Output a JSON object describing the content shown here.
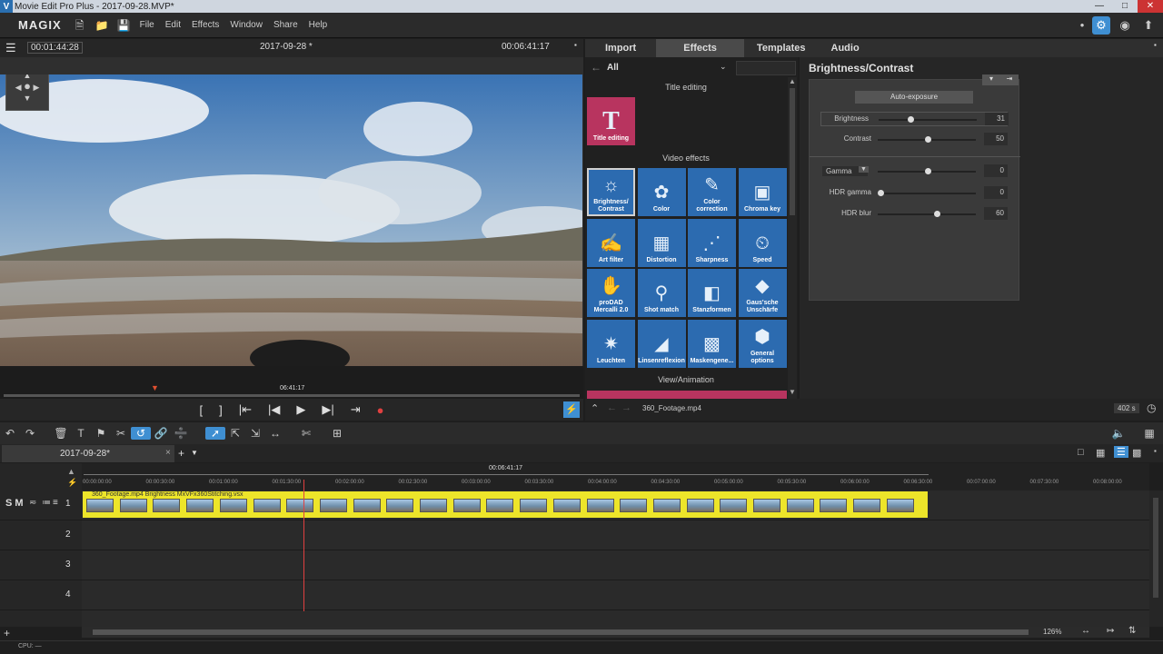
{
  "window": {
    "title": "Movie Edit Pro Plus - 2017-09-28.MVP*",
    "logo_letter": "V"
  },
  "menubar": {
    "brand": "MAGIX",
    "menus": [
      "File",
      "Edit",
      "Effects",
      "Window",
      "Share",
      "Help"
    ]
  },
  "monitor": {
    "timecode_left": "00:01:44:28",
    "project_title": "2017-09-28 *",
    "timecode_right": "00:06:41:17",
    "scrub_timecode": "06:41:17"
  },
  "media_pool": {
    "tabs": [
      "Import",
      "Effects",
      "Templates",
      "Audio"
    ],
    "active_tab": "Effects",
    "filter_value": "All",
    "section_title_editing": "Title editing",
    "title_tile_label": "Title editing",
    "section_video_effects": "Video effects",
    "section_view_animation": "View/Animation",
    "video_effects": [
      {
        "label": "Brightness/ Contrast",
        "icon": "sun-icon"
      },
      {
        "label": "Color",
        "icon": "palette-icon"
      },
      {
        "label": "Color correction",
        "icon": "color-correction-icon"
      },
      {
        "label": "Chroma key",
        "icon": "chroma-key-icon"
      },
      {
        "label": "Art filter",
        "icon": "art-filter-icon"
      },
      {
        "label": "Distortion",
        "icon": "distortion-icon"
      },
      {
        "label": "Sharpness",
        "icon": "sharpness-icon"
      },
      {
        "label": "Speed",
        "icon": "speed-icon"
      },
      {
        "label": "proDAD Mercalli 2.0",
        "icon": "hand-icon"
      },
      {
        "label": "Shot match",
        "icon": "shot-match-icon"
      },
      {
        "label": "Stanzformen",
        "icon": "stanzformen-icon"
      },
      {
        "label": "Gaus'sche Unschärfe",
        "icon": "drop-icon"
      },
      {
        "label": "Leuchten",
        "icon": "glow-icon"
      },
      {
        "label": "Linsenreflexion",
        "icon": "lens-flare-icon"
      },
      {
        "label": "Maskengene...",
        "icon": "mask-icon"
      },
      {
        "label": "General options",
        "icon": "hexagon-icon"
      }
    ]
  },
  "settings": {
    "heading": "Brightness/Contrast",
    "auto_exposure_label": "Auto-exposure",
    "sliders": [
      {
        "label": "Brightness",
        "value": "31",
        "fraction": 0.31
      },
      {
        "label": "Contrast",
        "value": "50",
        "fraction": 0.5
      },
      {
        "label": "Gamma",
        "value": "0",
        "fraction": 0.5
      },
      {
        "label": "HDR gamma",
        "value": "0",
        "fraction": 0.0
      },
      {
        "label": "HDR blur",
        "value": "60",
        "fraction": 0.6
      }
    ],
    "status_clip_name": "360_Footage.mp4",
    "status_duration": "402 s"
  },
  "timeline": {
    "project_tab": "2017-09-28*",
    "ruler_center": "00:06:41:17",
    "ruler_ticks": [
      "00:00:00:00",
      "00:00:30:00",
      "00:01:00:00",
      "00:01:30:00",
      "00:02:00:00",
      "00:02:30:00",
      "00:03:00:00",
      "00:03:30:00",
      "00:04:00:00",
      "00:04:30:00",
      "00:05:00:00",
      "00:05:30:00",
      "00:06:00:00",
      "00:06:30:00",
      "00:07:00:00",
      "00:07:30:00",
      "00:08:00:00"
    ],
    "track_numbers": [
      "1",
      "2",
      "3",
      "4"
    ],
    "track1_buttons": "S M",
    "clip_title": "360_Footage.mp4   Brightness   MxVFx360Stitching.vsx",
    "zoom": "126%",
    "cpu_label": "CPU: —"
  },
  "colors": {
    "accent": "#3f8fd2",
    "clip": "#ede52a",
    "tile_blue": "#2c6bb0",
    "tile_pink": "#b8345f",
    "record": "#e04040"
  }
}
